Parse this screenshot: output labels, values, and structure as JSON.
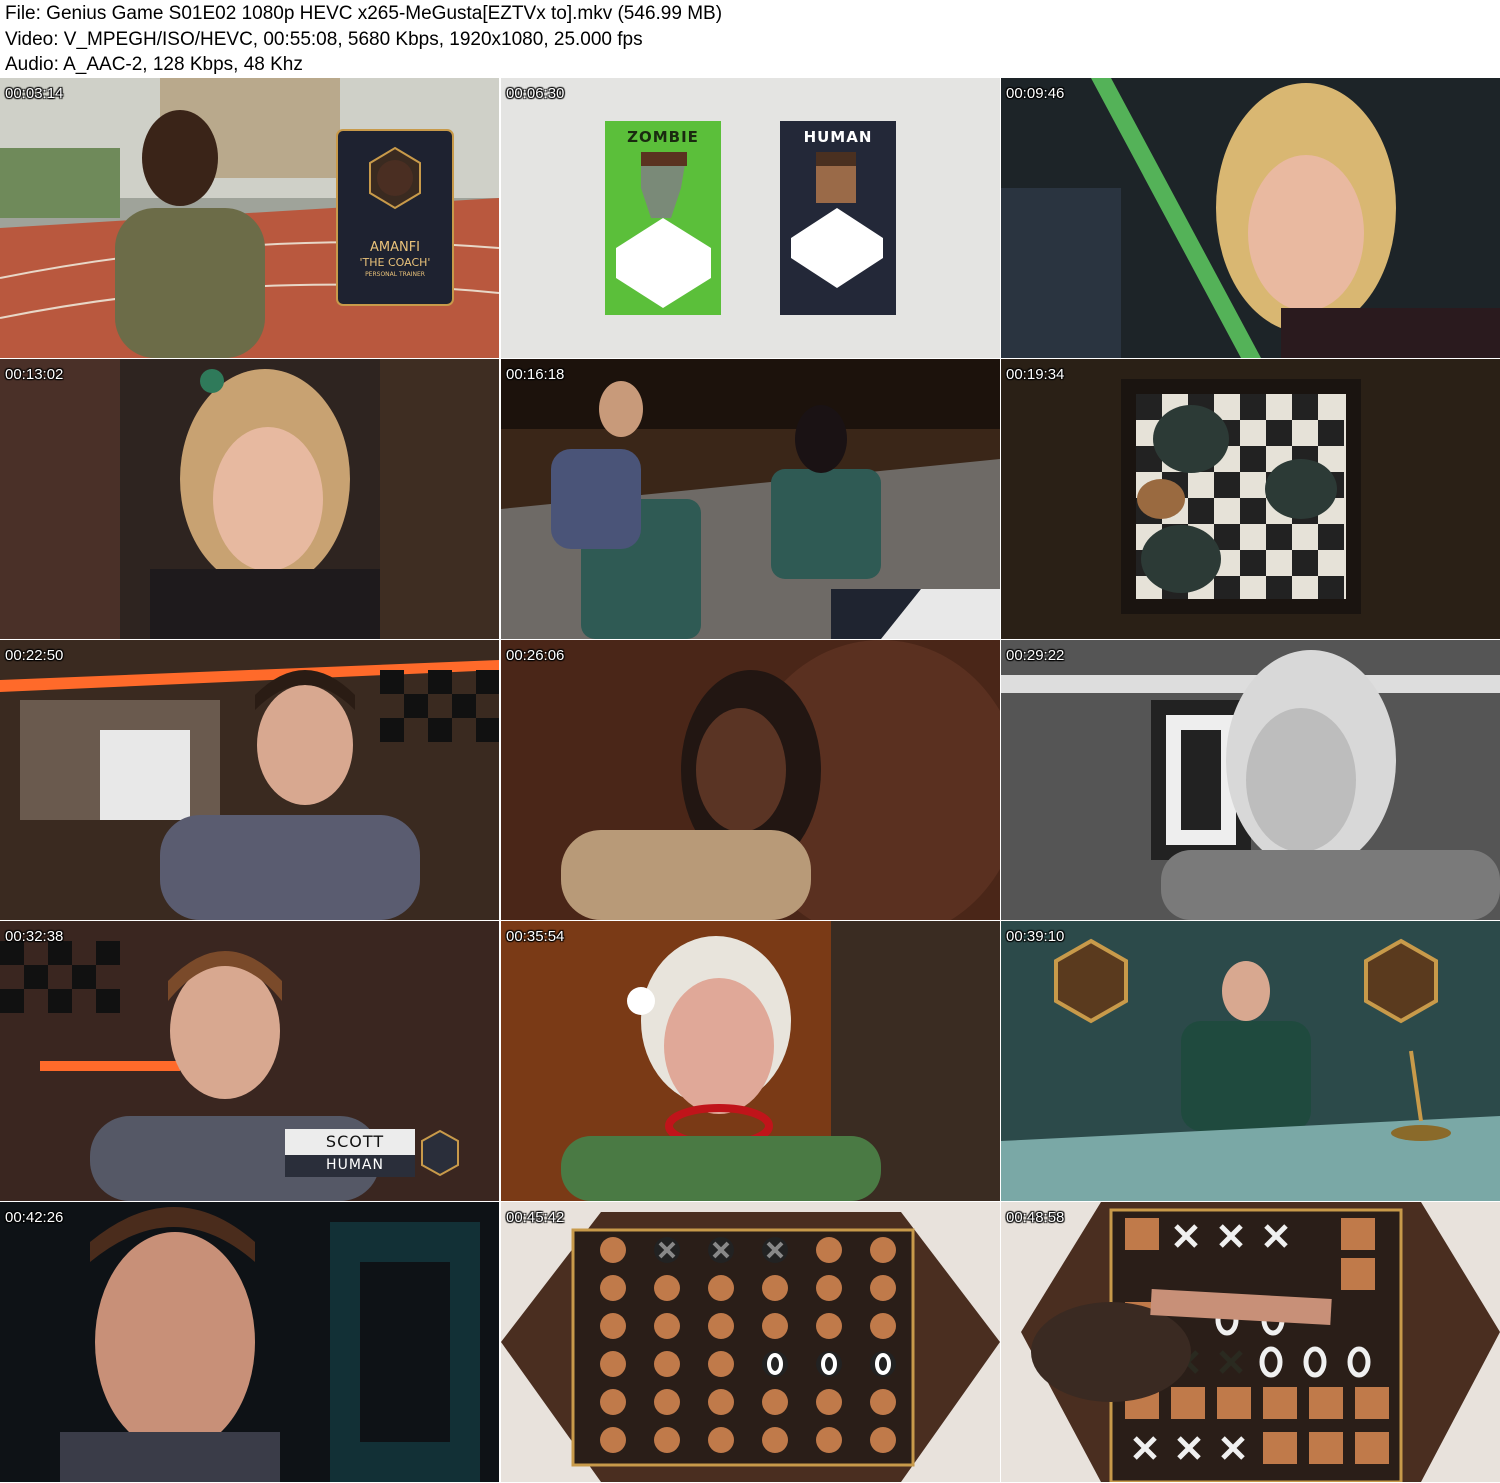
{
  "header": {
    "file": "File: Genius Game S01E02 1080p HEVC x265-MeGusta[EZTVx to].mkv (546.99 MB)",
    "video": "Video: V_MPEGH/ISO/HEVC, 00:55:08, 5680 Kbps, 1920x1080, 25.000 fps",
    "audio": "Audio: A_AAC-2, 128 Kbps, 48 Khz"
  },
  "thumbnails": [
    {
      "timestamp": "00:03:14",
      "card": {
        "name": "AMANFI",
        "nickname": "'THE COACH'",
        "role": "PERSONAL TRAINER"
      }
    },
    {
      "timestamp": "00:06:30",
      "cards": {
        "left": "ZOMBIE",
        "right": "HUMAN"
      }
    },
    {
      "timestamp": "00:09:46"
    },
    {
      "timestamp": "00:13:02"
    },
    {
      "timestamp": "00:16:18"
    },
    {
      "timestamp": "00:19:34"
    },
    {
      "timestamp": "00:22:50"
    },
    {
      "timestamp": "00:26:06"
    },
    {
      "timestamp": "00:29:22"
    },
    {
      "timestamp": "00:32:38",
      "caption": {
        "name": "SCOTT",
        "role": "HUMAN"
      }
    },
    {
      "timestamp": "00:35:54"
    },
    {
      "timestamp": "00:39:10"
    },
    {
      "timestamp": "00:42:26"
    },
    {
      "timestamp": "00:45:42"
    },
    {
      "timestamp": "00:48:58"
    }
  ],
  "colors": {
    "zombie_card": "#5bbf3a",
    "human_card": "#232838",
    "card_gold": "#c89a4a",
    "orange_light": "#ff6a2a"
  }
}
